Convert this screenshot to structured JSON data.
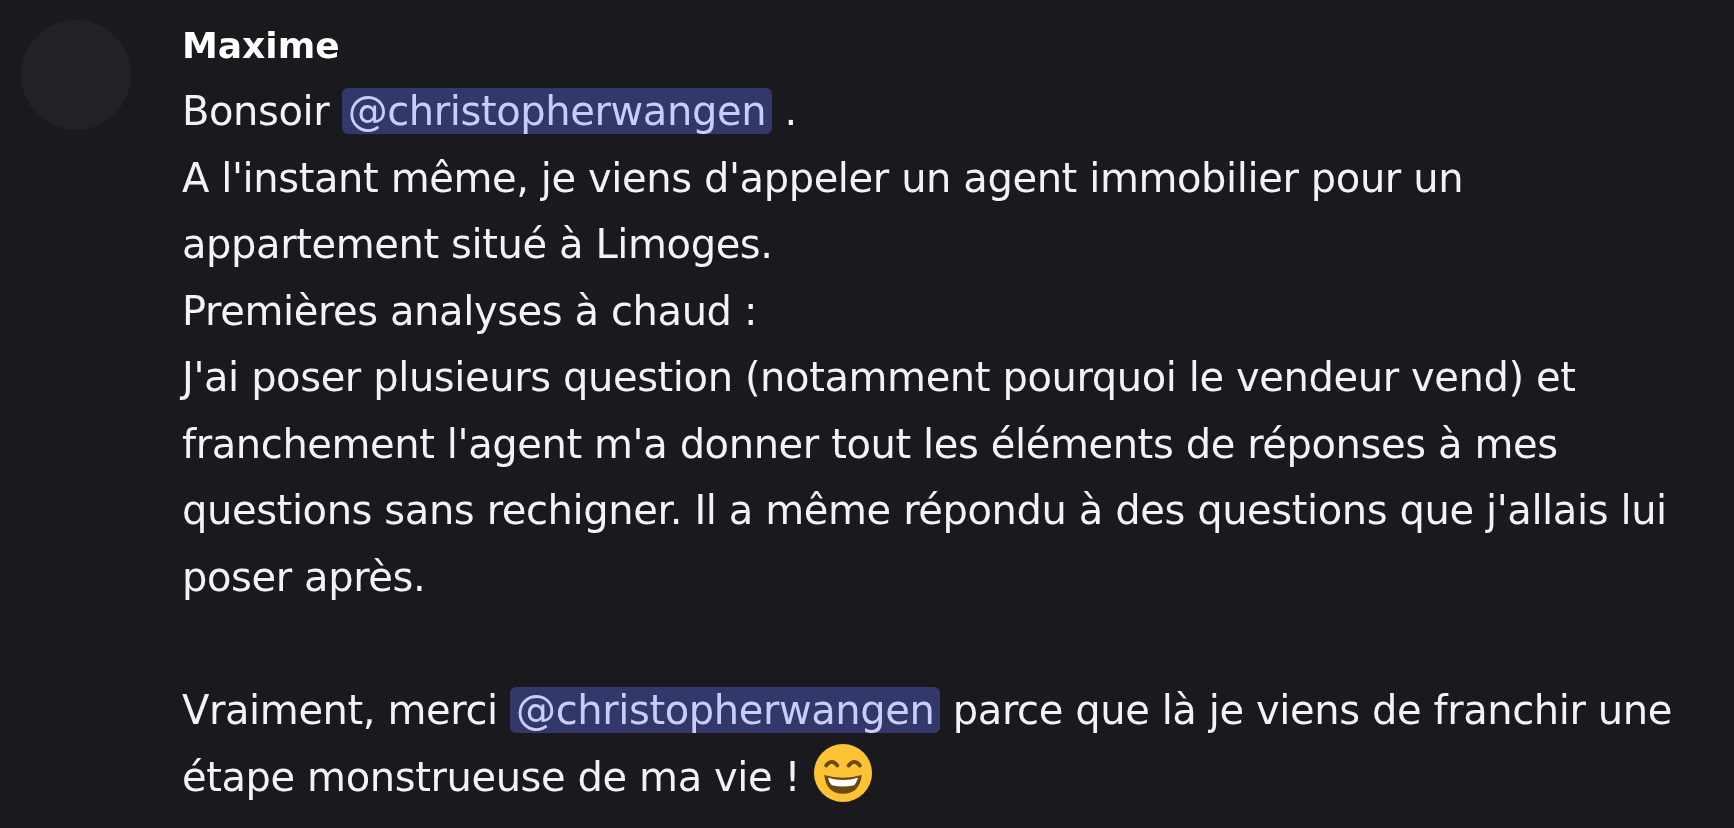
{
  "message": {
    "author": "Maxime",
    "paragraphs": [
      {
        "segments": [
          {
            "kind": "text",
            "text": "Bonsoir "
          },
          {
            "kind": "mention",
            "text": "@christopherwangen"
          },
          {
            "kind": "text",
            "text": " ."
          }
        ]
      },
      {
        "segments": [
          {
            "kind": "text",
            "text": "A l'instant même, je viens d'appeler un agent immobilier pour un appartement situé à Limoges."
          }
        ]
      },
      {
        "segments": [
          {
            "kind": "text",
            "text": "Premières analyses à chaud :"
          }
        ]
      },
      {
        "segments": [
          {
            "kind": "text",
            "text": "J'ai poser plusieurs question (notamment pourquoi le vendeur vend) et franchement l'agent m'a donner tout les éléments de réponses à mes questions sans rechigner. Il a même répondu à des questions que j'allais lui poser après."
          }
        ]
      },
      {
        "blank_line_before": true,
        "segments": [
          {
            "kind": "text",
            "text": "Vraiment, merci "
          },
          {
            "kind": "mention",
            "text": "@christopherwangen"
          },
          {
            "kind": "text",
            "text": " parce que là je viens de franchir une étape monstrueuse de ma vie ! "
          },
          {
            "kind": "emoji"
          }
        ]
      }
    ]
  }
}
